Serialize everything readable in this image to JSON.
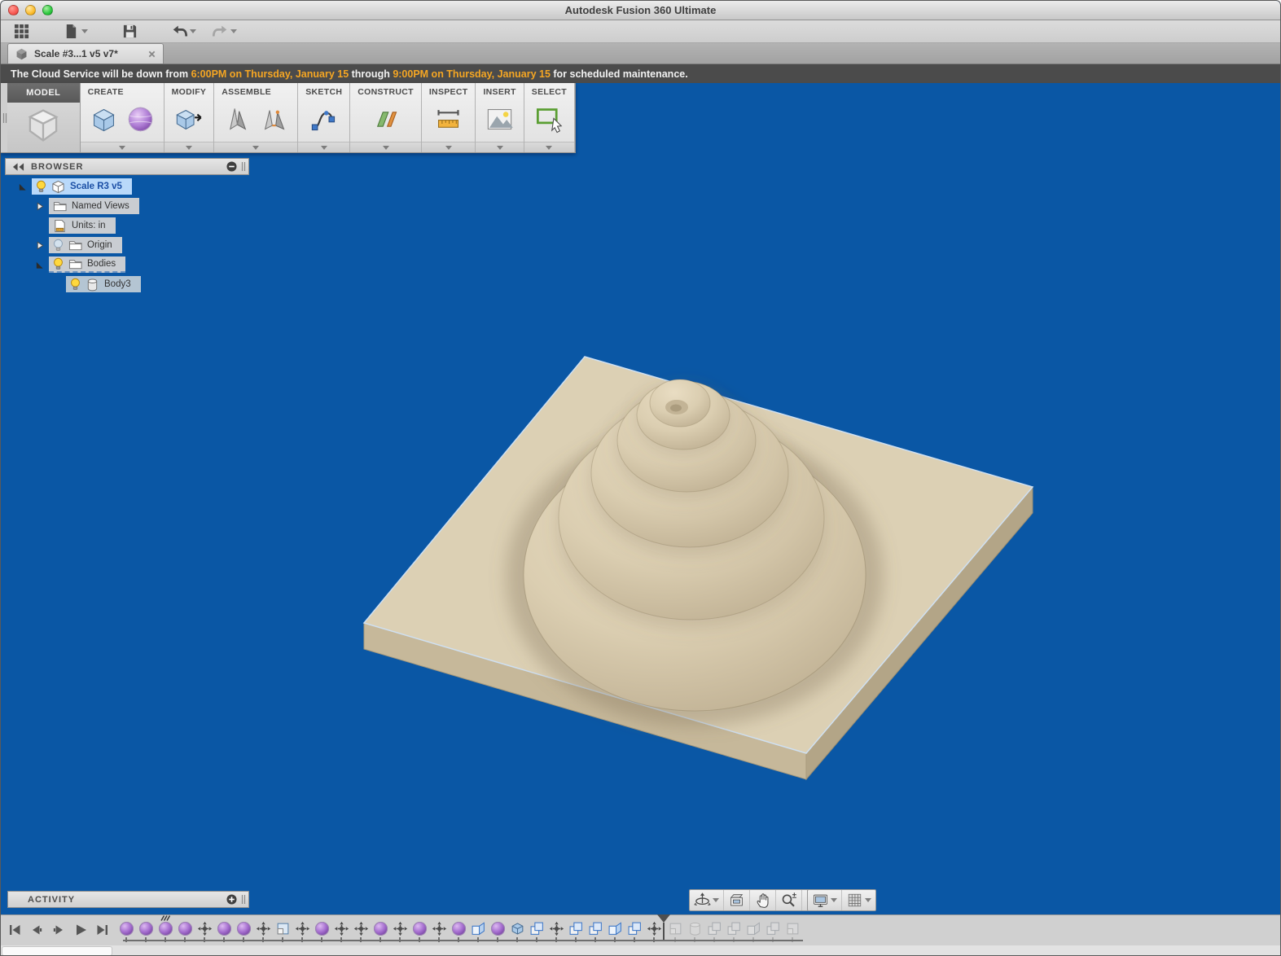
{
  "window": {
    "title": "Autodesk Fusion 360 Ultimate"
  },
  "traffic_lights": [
    {
      "name": "close-window-button",
      "color": "red"
    },
    {
      "name": "minimize-window-button",
      "color": "yellow"
    },
    {
      "name": "zoom-window-button",
      "color": "green"
    }
  ],
  "qat": {
    "buttons": [
      {
        "icon": "app-grid-icon",
        "caret": false
      },
      {
        "icon": "file-icon",
        "caret": true
      },
      {
        "icon": "save-icon",
        "caret": false
      },
      {
        "icon": "undo-icon",
        "caret": true
      },
      {
        "icon": "redo-icon",
        "caret": true,
        "disabled": true
      }
    ]
  },
  "tab": {
    "title": "Scale #3...1 v5 v7*",
    "icon": "document-cube-icon",
    "close_glyph": "×"
  },
  "notification": {
    "part1": "The Cloud Service will be down from ",
    "time1": "6:00PM on Thursday, January 15",
    "part2": " through ",
    "time2": "9:00PM on Thursday, January 15",
    "part3": " for scheduled maintenance."
  },
  "ribbon": {
    "workspace_label": "MODEL",
    "workspace_icon": "model-cube-icon",
    "groups": [
      {
        "label": "CREATE",
        "icons": [
          "box-icon",
          "form-sphere-icon"
        ]
      },
      {
        "label": "MODIFY",
        "icons": [
          "press-pull-icon"
        ]
      },
      {
        "label": "ASSEMBLE",
        "icons": [
          "new-component-icon",
          "joint-icon"
        ]
      },
      {
        "label": "SKETCH",
        "icons": [
          "spline-icon"
        ]
      },
      {
        "label": "CONSTRUCT",
        "icons": [
          "construct-plane-icon"
        ]
      },
      {
        "label": "INSPECT",
        "icons": [
          "measure-icon"
        ]
      },
      {
        "label": "INSERT",
        "icons": [
          "insert-image-icon"
        ]
      },
      {
        "label": "SELECT",
        "icons": [
          "select-icon"
        ]
      }
    ]
  },
  "browser": {
    "title": "BROWSER",
    "items": [
      {
        "label": "Scale R3 v5",
        "depth": 0,
        "expander": "expanded",
        "bulb": "on",
        "icon": "component-icon",
        "state": "selected"
      },
      {
        "label": "Named Views",
        "depth": 1,
        "expander": "collapsed",
        "bulb": null,
        "icon": "folder-icon",
        "state": "normal"
      },
      {
        "label": "Units: in",
        "depth": 1,
        "expander": null,
        "bulb": null,
        "icon": "units-icon",
        "state": "normal"
      },
      {
        "label": "Origin",
        "depth": 1,
        "expander": "collapsed",
        "bulb": "off",
        "icon": "folder-icon",
        "state": "normal"
      },
      {
        "label": "Bodies",
        "depth": 1,
        "expander": "expanded",
        "bulb": "on",
        "icon": "folder-icon",
        "state": "dashed"
      },
      {
        "label": "Body3",
        "depth": 2,
        "expander": null,
        "bulb": "on",
        "icon": "body-icon",
        "state": "secondary"
      }
    ]
  },
  "activity": {
    "title": "ACTIVITY"
  },
  "navbar": {
    "main_buttons": [
      {
        "icon": "orbit-icon",
        "caret": true
      },
      {
        "icon": "look-at-icon",
        "caret": false
      },
      {
        "icon": "pan-icon",
        "caret": false
      },
      {
        "icon": "zoom-icon",
        "caret": false
      },
      {
        "icon": "fit-icon",
        "caret": false
      }
    ],
    "display_buttons": [
      {
        "icon": "display-settings-icon",
        "caret": true
      },
      {
        "icon": "grid-settings-icon",
        "caret": true
      }
    ]
  },
  "timeline": {
    "playback": [
      "skip-start-icon",
      "step-back-icon",
      "step-forward-icon",
      "play-icon",
      "skip-end-icon"
    ],
    "past_features": [
      "form",
      "form",
      "form",
      "form",
      "move",
      "form",
      "form",
      "move",
      "scale",
      "move",
      "form",
      "move",
      "move",
      "form",
      "move",
      "form",
      "move",
      "form",
      "combine",
      "form",
      "box",
      "duplicate",
      "move",
      "duplicate",
      "duplicate",
      "combine",
      "duplicate",
      "move"
    ],
    "marker_index": 2,
    "future_features": [
      "scale",
      "cylinder",
      "duplicate",
      "duplicate",
      "combine",
      "duplicate",
      "scale"
    ]
  },
  "colors": {
    "viewport_bg": "#0a57a5",
    "accent_orange": "#f5a623",
    "selection_blue": "#b9d9fa",
    "model_tan_top": "#dcd0b4",
    "model_tan_side": "#b7a98b",
    "form_purple": "#a66fd0"
  }
}
